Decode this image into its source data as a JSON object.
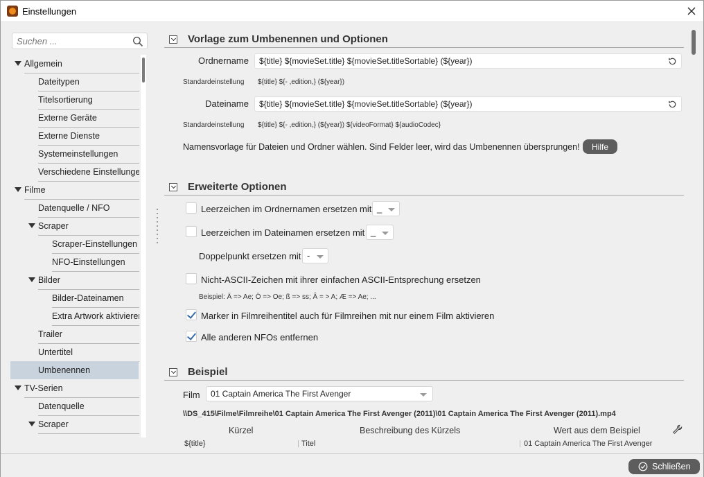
{
  "window": {
    "title": "Einstellungen"
  },
  "sidebar": {
    "search_placeholder": "Suchen ...",
    "items": [
      {
        "label": "Allgemein",
        "level": 0,
        "expanded": true
      },
      {
        "label": "Dateitypen",
        "level": 1
      },
      {
        "label": "Titelsortierung",
        "level": 1
      },
      {
        "label": "Externe Geräte",
        "level": 1
      },
      {
        "label": "Externe Dienste",
        "level": 1
      },
      {
        "label": "Systemeinstellungen",
        "level": 1
      },
      {
        "label": "Verschiedene Einstellungen",
        "level": 1
      },
      {
        "label": "Filme",
        "level": 0,
        "expanded": true
      },
      {
        "label": "Datenquelle / NFO",
        "level": 1
      },
      {
        "label": "Scraper",
        "level": 1,
        "expanded": true
      },
      {
        "label": "Scraper-Einstellungen",
        "level": 2
      },
      {
        "label": "NFO-Einstellungen",
        "level": 2
      },
      {
        "label": "Bilder",
        "level": 1,
        "expanded": true
      },
      {
        "label": "Bilder-Dateinamen",
        "level": 2
      },
      {
        "label": "Extra Artwork aktivieren",
        "level": 2
      },
      {
        "label": "Trailer",
        "level": 1
      },
      {
        "label": "Untertitel",
        "level": 1
      },
      {
        "label": "Umbenennen",
        "level": 1,
        "selected": true
      },
      {
        "label": "TV-Serien",
        "level": 0,
        "expanded": true
      },
      {
        "label": "Datenquelle",
        "level": 1
      },
      {
        "label": "Scraper",
        "level": 1,
        "expanded": true
      }
    ]
  },
  "template_section": {
    "title": "Vorlage zum Umbenennen und Optionen",
    "folder_label": "Ordnername",
    "folder_value": "${title} ${movieSet.title} ${movieSet.titleSortable} (${year})",
    "folder_default_label": "Standardeinstellung",
    "folder_default_value": "${title} ${- ,edition,} (${year})",
    "file_label": "Dateiname",
    "file_value": "${title} ${movieSet.title} ${movieSet.titleSortable} (${year})",
    "file_default_label": "Standardeinstellung",
    "file_default_value": "${title} ${- ,edition,} (${year}) ${videoFormat} ${audioCodec}",
    "hint": "Namensvorlage für Dateien und Ordner wählen. Sind Felder leer, wird das Umbenennen übersprungen!",
    "help_label": "Hilfe"
  },
  "advanced_section": {
    "title": "Erweiterte Optionen",
    "space_folder_label": "Leerzeichen im Ordnernamen ersetzen mit",
    "space_folder_value": "_",
    "space_folder_checked": false,
    "space_file_label": "Leerzeichen im Dateinamen ersetzen mit",
    "space_file_value": "_",
    "space_file_checked": false,
    "colon_label": "Doppelpunkt ersetzen mit",
    "colon_value": "-",
    "ascii_label": "Nicht-ASCII-Zeichen mit ihrer einfachen ASCII-Entsprechung ersetzen",
    "ascii_checked": false,
    "ascii_example": "Beispiel: Ä => Ae; Ö => Oe; ß => ss; Â = > A; Æ => Ae; ...",
    "marker_label": "Marker in Filmreihentitel auch für Filmreihen mit nur einem Film aktivieren",
    "marker_checked": true,
    "nfo_label": "Alle anderen NFOs entfernen",
    "nfo_checked": true
  },
  "example_section": {
    "title": "Beispiel",
    "film_label": "Film",
    "film_value": "01 Captain America The First Avenger",
    "path": "\\\\DS_415\\Filme\\Filmreihe\\01 Captain America The First Avenger (2011)\\01 Captain America The First Avenger (2011).mp4",
    "columns": [
      "Kürzel",
      "Beschreibung des Kürzels",
      "Wert aus dem Beispiel"
    ],
    "first_row": [
      "${title}",
      "Titel",
      "01 Captain America The First Avenger"
    ]
  },
  "footer": {
    "close_label": "Schließen"
  }
}
